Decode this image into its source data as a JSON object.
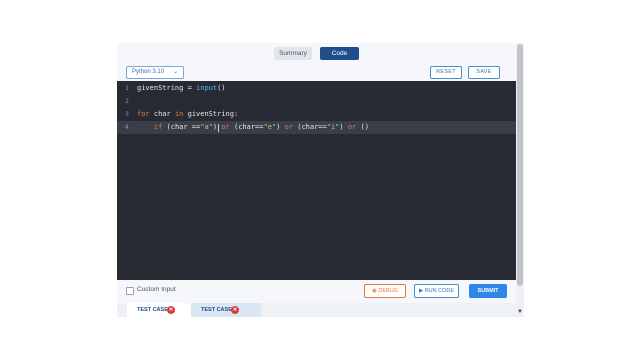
{
  "tabs": {
    "summary": "Summary",
    "code": "Code"
  },
  "toolbar": {
    "language": "Python 3.10",
    "reset": "RESET",
    "save": "SAVE"
  },
  "editor": {
    "lines": [
      {
        "num": "1",
        "parts": [
          [
            "fn-name",
            "givenString"
          ],
          [
            "op",
            " = "
          ],
          [
            "fn",
            "input"
          ],
          [
            "op",
            "()"
          ]
        ]
      },
      {
        "num": "2",
        "parts": []
      },
      {
        "num": "3",
        "parts": [
          [
            "kw",
            "for"
          ],
          [
            "op",
            " char "
          ],
          [
            "kw",
            "in"
          ],
          [
            "op",
            " givenString:"
          ]
        ]
      },
      {
        "num": "4",
        "parts": [
          [
            "op",
            "    "
          ],
          [
            "kw",
            "if"
          ],
          [
            "op",
            " (char =="
          ],
          [
            "str",
            "\"a\""
          ],
          [
            "op",
            ") "
          ],
          [
            "kw",
            "or"
          ],
          [
            "op",
            " (char=="
          ],
          [
            "str",
            "\"e\""
          ],
          [
            "op",
            ") "
          ],
          [
            "kw",
            "or"
          ],
          [
            "op",
            " (char=="
          ],
          [
            "str",
            "\"i\""
          ],
          [
            "op",
            ") "
          ],
          [
            "kw",
            "or"
          ],
          [
            "op",
            " ()"
          ]
        ]
      }
    ],
    "active_line": 4
  },
  "bottom": {
    "custom_input": "Custom Input",
    "debug": "DEBUG",
    "run_code": "RUN CODE",
    "submit": "SUBMIT"
  },
  "test_cases": [
    {
      "label": "TEST CASE 1",
      "status": "failed"
    },
    {
      "label": "TEST CASE 2",
      "status": "failed"
    }
  ],
  "icons": {
    "language_dropdown": "chevron-down-icon",
    "debug": "bug-icon",
    "run": "play-icon",
    "test_status": "close-circle-icon"
  },
  "colors": {
    "accent": "#1f4e8c",
    "submit": "#2f86e6",
    "debug": "#e07b3a",
    "editor_bg": "#272a33",
    "error": "#d63b3b"
  }
}
